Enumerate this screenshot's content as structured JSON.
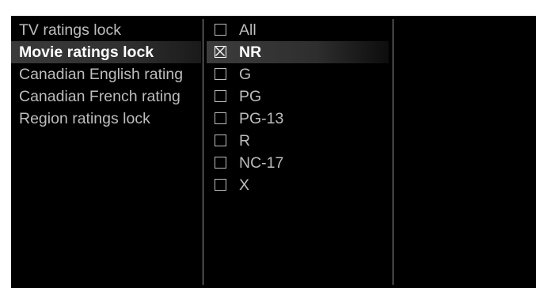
{
  "menu": {
    "items": [
      {
        "label": "TV ratings lock"
      },
      {
        "label": "Movie ratings lock"
      },
      {
        "label": "Canadian English rating"
      },
      {
        "label": "Canadian French rating"
      },
      {
        "label": "Region ratings lock"
      }
    ],
    "selected_label": "Movie ratings lock"
  },
  "ratings": {
    "options": [
      {
        "label": "All",
        "checked": false
      },
      {
        "label": "NR",
        "checked": true
      },
      {
        "label": "G",
        "checked": false
      },
      {
        "label": "PG",
        "checked": false
      },
      {
        "label": "PG-13",
        "checked": false
      },
      {
        "label": "R",
        "checked": false
      },
      {
        "label": "NC-17",
        "checked": false
      },
      {
        "label": "X",
        "checked": false
      }
    ],
    "focused_label": "NR"
  },
  "colors": {
    "background": "#000000",
    "text": "#bdbdbd",
    "selected_text": "#ffffff"
  }
}
